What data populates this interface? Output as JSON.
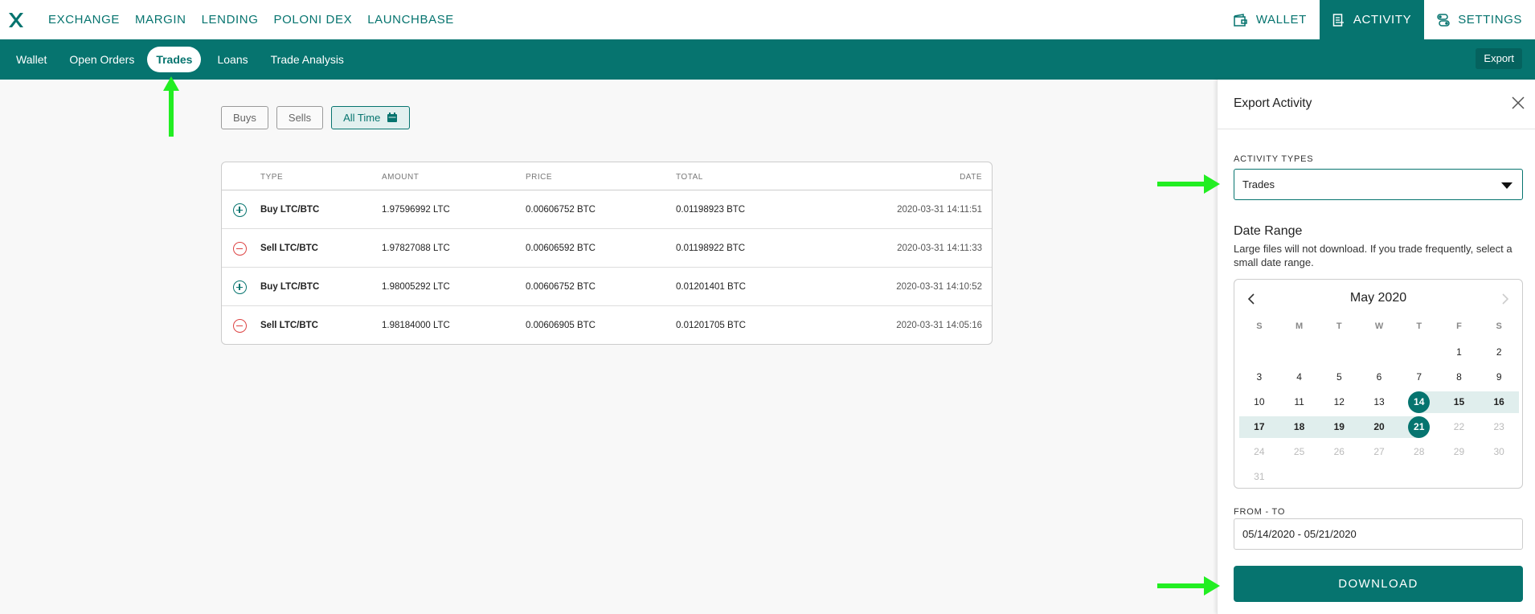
{
  "topnav": {
    "items": [
      "EXCHANGE",
      "MARGIN",
      "LENDING",
      "POLONI DEX",
      "LAUNCHBASE"
    ],
    "wallet": "WALLET",
    "activity": "ACTIVITY",
    "settings": "SETTINGS"
  },
  "subnav": {
    "items": [
      "Wallet",
      "Open Orders",
      "Trades",
      "Loans",
      "Trade Analysis"
    ],
    "active": "Trades",
    "export": "Export"
  },
  "filters": {
    "buys": "Buys",
    "sells": "Sells",
    "all_time": "All Time"
  },
  "table": {
    "headers": {
      "type": "TYPE",
      "amount": "AMOUNT",
      "price": "PRICE",
      "total": "TOTAL",
      "date": "DATE"
    },
    "rows": [
      {
        "side": "buy",
        "type": "Buy LTC/BTC",
        "amount": "1.97596992 LTC",
        "price": "0.00606752 BTC",
        "total": "0.01198923 BTC",
        "date": "2020-03-31 14:11:51"
      },
      {
        "side": "sell",
        "type": "Sell LTC/BTC",
        "amount": "1.97827088 LTC",
        "price": "0.00606592 BTC",
        "total": "0.01198922 BTC",
        "date": "2020-03-31 14:11:33"
      },
      {
        "side": "buy",
        "type": "Buy LTC/BTC",
        "amount": "1.98005292 LTC",
        "price": "0.00606752 BTC",
        "total": "0.01201401 BTC",
        "date": "2020-03-31 14:10:52"
      },
      {
        "side": "sell",
        "type": "Sell LTC/BTC",
        "amount": "1.98184000 LTC",
        "price": "0.00606905 BTC",
        "total": "0.01201705 BTC",
        "date": "2020-03-31 14:05:16"
      }
    ]
  },
  "panel": {
    "title": "Export Activity",
    "activity_types_label": "ACTIVITY TYPES",
    "activity_type_value": "Trades",
    "date_range_title": "Date Range",
    "date_range_note": "Large files will not download. If you trade frequently, select a small date range.",
    "calendar": {
      "month": "May 2020",
      "dow": [
        "S",
        "M",
        "T",
        "W",
        "T",
        "F",
        "S"
      ],
      "weeks": [
        [
          "",
          "",
          "",
          "",
          "",
          "1",
          "2"
        ],
        [
          "3",
          "4",
          "5",
          "6",
          "7",
          "8",
          "9"
        ],
        [
          "10",
          "11",
          "12",
          "13",
          "14",
          "15",
          "16"
        ],
        [
          "17",
          "18",
          "19",
          "20",
          "21",
          "22",
          "23"
        ],
        [
          "24",
          "25",
          "26",
          "27",
          "28",
          "29",
          "30"
        ],
        [
          "31",
          "",
          "",
          "",
          "",
          "",
          ""
        ]
      ],
      "range_start": "14",
      "range_end": "21",
      "disabled_after": "21"
    },
    "from_to_label": "FROM - TO",
    "from_to_value": "05/14/2020 - 05/21/2020",
    "download": "DOWNLOAD"
  },
  "colors": {
    "brand": "#06746f",
    "sell": "#dd4444",
    "annotation": "#22ee22"
  }
}
